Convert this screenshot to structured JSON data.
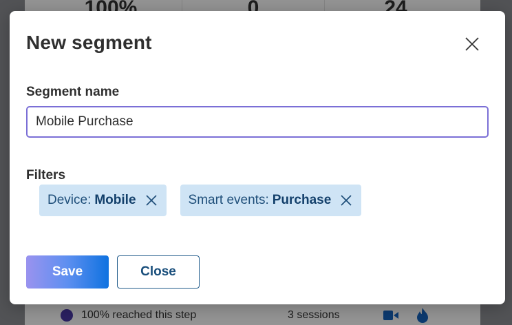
{
  "background": {
    "stats": [
      "100%",
      "0",
      "24"
    ],
    "step": {
      "text": "100% reached this step",
      "sessions": "3 sessions",
      "icons": [
        "video-camera-icon",
        "flame-icon"
      ]
    }
  },
  "dialog": {
    "title": "New segment",
    "close_icon": "close-icon",
    "segment_name_label": "Segment name",
    "segment_name_value": "Mobile Purchase",
    "filters_label": "Filters",
    "filters": [
      {
        "key": "Device:",
        "value": "Mobile"
      },
      {
        "key": "Smart events:",
        "value": "Purchase"
      }
    ],
    "save_label": "Save",
    "close_label": "Close"
  },
  "colors": {
    "accent": "#7b6fd6",
    "chip_bg": "#cfe4f5",
    "chip_text": "#13406b",
    "save_gradient_start": "#9a93ef",
    "save_gradient_end": "#0f72e0"
  }
}
